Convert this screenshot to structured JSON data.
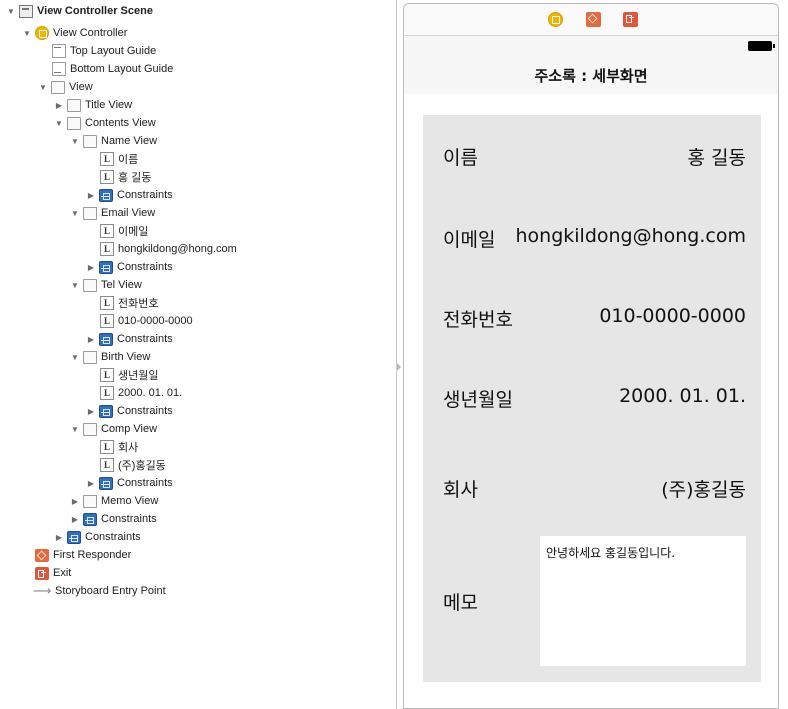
{
  "outline": {
    "scene": "View Controller Scene",
    "view_controller": "View Controller",
    "top_layout_guide": "Top Layout Guide",
    "bottom_layout_guide": "Bottom Layout Guide",
    "view": "View",
    "title_view": "Title View",
    "contents_view": "Contents View",
    "name_view": "Name View",
    "name_label": "이름",
    "name_value": "홍 길동",
    "email_view": "Email View",
    "email_label": "이메일",
    "email_value": "hongkildong@hong.com",
    "tel_view": "Tel View",
    "tel_label": "전화번호",
    "tel_value": "010-0000-0000",
    "birth_view": "Birth View",
    "birth_label": "생년월일",
    "birth_value": "2000. 01. 01.",
    "comp_view": "Comp View",
    "comp_label": "회사",
    "comp_value": "(주)홍길동",
    "memo_view": "Memo View",
    "constraints": "Constraints",
    "first_responder": "First Responder",
    "exit": "Exit",
    "entry_point": "Storyboard Entry Point",
    "label_glyph": "L"
  },
  "screen": {
    "nav_title": "주소록 : 세부화면",
    "fields": {
      "name_label": "이름",
      "name_value": "홍 길동",
      "email_label": "이메일",
      "email_value": "hongkildong@hong.com",
      "tel_label": "전화번호",
      "tel_value": "010-0000-0000",
      "birth_label": "생년월일",
      "birth_value": "2000. 01. 01.",
      "comp_label": "회사",
      "comp_value": "(주)홍길동",
      "memo_label": "메모",
      "memo_text": "안녕하세요 홍길동입니다."
    }
  },
  "colors": {
    "view_controller_icon": "#f2b500",
    "first_responder_icon": "#e6693e",
    "exit_icon": "#e0563a",
    "constraints_icon": "#2f6fbf",
    "contents_background": "#e6e6e6"
  }
}
